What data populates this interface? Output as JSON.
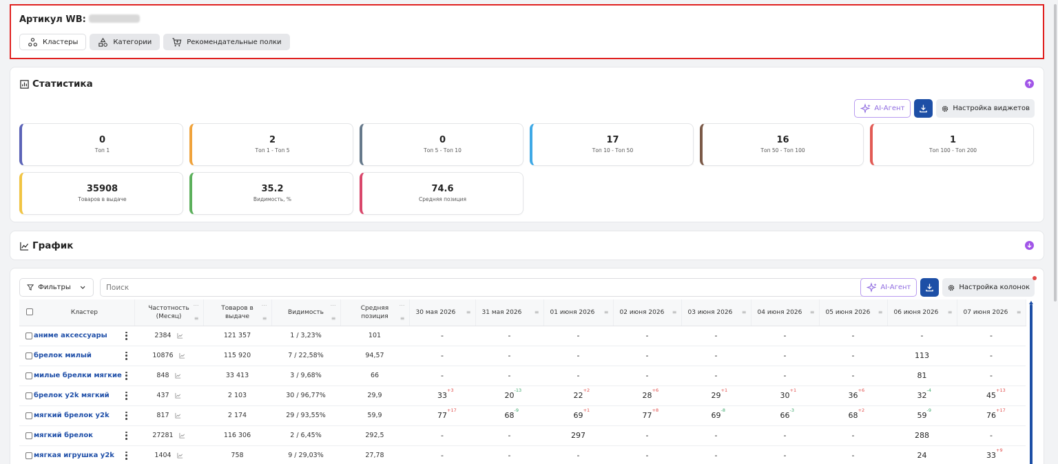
{
  "article": {
    "label": "Артикул WB:"
  },
  "tabs": [
    {
      "label": "Кластеры",
      "icon": "clusters-icon"
    },
    {
      "label": "Категории",
      "icon": "categories-icon"
    },
    {
      "label": "Рекомендательные полки",
      "icon": "cart-icon"
    }
  ],
  "stats": {
    "title": "Статистика",
    "ai_label": "AI-Агент",
    "widgets_label": "Настройка виджетов",
    "items": [
      {
        "value": "0",
        "label": "Топ 1",
        "color": "#5b63b7"
      },
      {
        "value": "2",
        "label": "Топ 1 - Топ 5",
        "color": "#f0a33c"
      },
      {
        "value": "0",
        "label": "Топ 5 - Топ 10",
        "color": "#66798b"
      },
      {
        "value": "17",
        "label": "Топ 10 - Топ 50",
        "color": "#3fa9e6"
      },
      {
        "value": "16",
        "label": "Топ 50 - Топ 100",
        "color": "#7b5a48"
      },
      {
        "value": "1",
        "label": "Топ 100 - Топ 200",
        "color": "#e25b55"
      },
      {
        "value": "35908",
        "label": "Товаров в выдаче",
        "color": "#f1c443"
      },
      {
        "value": "35.2",
        "label": "Видимость, %",
        "color": "#5cb05c"
      },
      {
        "value": "74.6",
        "label": "Средняя позиция",
        "color": "#d9476b"
      }
    ]
  },
  "graph": {
    "title": "График"
  },
  "table": {
    "filters_label": "Фильтры",
    "search_placeholder": "Поиск",
    "ai_label": "AI-Агент",
    "columns_label": "Настройка колонок",
    "headers": {
      "cluster": "Кластер",
      "freq": [
        "Частотность",
        "(Месяц)"
      ],
      "goods": [
        "Товаров в",
        "выдаче"
      ],
      "visibility": "Видимость",
      "avgpos": [
        "Средняя",
        "позиция"
      ],
      "dates": [
        "30 мая 2026",
        "31 мая 2026",
        "01 июня 2026",
        "02 июня 2026",
        "03 июня 2026",
        "04 июня 2026",
        "05 июня 2026",
        "06 июня 2026",
        "07 июня 2026"
      ]
    },
    "rows": [
      {
        "cluster": "аниме аксессуары",
        "freq": "2384",
        "goods": "121 357",
        "vis": "1 / 3,23%",
        "avg": "101",
        "days": [
          {
            "v": "-"
          },
          {
            "v": "-"
          },
          {
            "v": "-"
          },
          {
            "v": "-"
          },
          {
            "v": "-"
          },
          {
            "v": "-"
          },
          {
            "v": "-"
          },
          {
            "v": "-"
          },
          {
            "v": "-"
          }
        ]
      },
      {
        "cluster": "брелок милый",
        "freq": "10876",
        "goods": "115 920",
        "vis": "7 / 22,58%",
        "avg": "94,57",
        "days": [
          {
            "v": "-"
          },
          {
            "v": "-"
          },
          {
            "v": "-"
          },
          {
            "v": "-"
          },
          {
            "v": "-"
          },
          {
            "v": "-"
          },
          {
            "v": "-"
          },
          {
            "v": "113"
          },
          {
            "v": "-"
          }
        ]
      },
      {
        "cluster": "милые брелки мягкие",
        "freq": "848",
        "goods": "33 413",
        "vis": "3 / 9,68%",
        "avg": "66",
        "days": [
          {
            "v": "-"
          },
          {
            "v": "-"
          },
          {
            "v": "-"
          },
          {
            "v": "-"
          },
          {
            "v": "-"
          },
          {
            "v": "-"
          },
          {
            "v": "-"
          },
          {
            "v": "81"
          },
          {
            "v": "-"
          }
        ]
      },
      {
        "cluster": "брелок y2k мягкий",
        "freq": "437",
        "goods": "2 103",
        "vis": "30 / 96,77%",
        "avg": "29,9",
        "days": [
          {
            "v": "33",
            "d": "+3",
            "t": "up"
          },
          {
            "v": "20",
            "d": "-13",
            "t": "down"
          },
          {
            "v": "22",
            "d": "+2",
            "t": "up"
          },
          {
            "v": "28",
            "d": "+6",
            "t": "up"
          },
          {
            "v": "29",
            "d": "+1",
            "t": "up"
          },
          {
            "v": "30",
            "d": "+1",
            "t": "up"
          },
          {
            "v": "36",
            "d": "+6",
            "t": "up"
          },
          {
            "v": "32",
            "d": "-4",
            "t": "down"
          },
          {
            "v": "45",
            "d": "+13",
            "t": "up"
          }
        ]
      },
      {
        "cluster": "мягкий брелок y2k",
        "freq": "817",
        "goods": "2 174",
        "vis": "29 / 93,55%",
        "avg": "59,9",
        "days": [
          {
            "v": "77",
            "d": "+17",
            "t": "up"
          },
          {
            "v": "68",
            "d": "-9",
            "t": "down"
          },
          {
            "v": "69",
            "d": "+1",
            "t": "up"
          },
          {
            "v": "77",
            "d": "+8",
            "t": "up"
          },
          {
            "v": "69",
            "d": "-8",
            "t": "down"
          },
          {
            "v": "66",
            "d": "-3",
            "t": "down"
          },
          {
            "v": "68",
            "d": "+2",
            "t": "up"
          },
          {
            "v": "59",
            "d": "-9",
            "t": "down"
          },
          {
            "v": "76",
            "d": "+17",
            "t": "up"
          }
        ]
      },
      {
        "cluster": "мягкий брелок",
        "freq": "27281",
        "goods": "116 306",
        "vis": "2 / 6,45%",
        "avg": "292,5",
        "days": [
          {
            "v": "-"
          },
          {
            "v": "-"
          },
          {
            "v": "297"
          },
          {
            "v": "-"
          },
          {
            "v": "-"
          },
          {
            "v": "-"
          },
          {
            "v": "-"
          },
          {
            "v": "288"
          },
          {
            "v": "-"
          }
        ]
      },
      {
        "cluster": "мягкая игрушка y2k",
        "freq": "1404",
        "goods": "758",
        "vis": "9 / 29,03%",
        "avg": "27,78",
        "days": [
          {
            "v": "-"
          },
          {
            "v": "-"
          },
          {
            "v": "-"
          },
          {
            "v": "-"
          },
          {
            "v": "-"
          },
          {
            "v": "-"
          },
          {
            "v": "-"
          },
          {
            "v": "24"
          },
          {
            "v": "33",
            "d": "+9",
            "t": "up"
          }
        ]
      }
    ]
  }
}
